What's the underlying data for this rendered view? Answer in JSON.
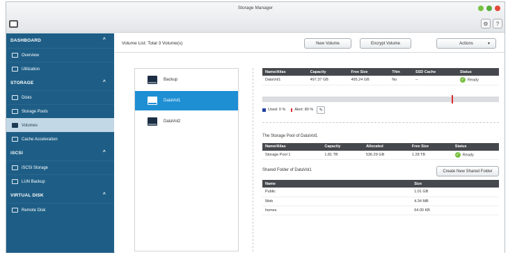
{
  "window": {
    "title": "Storage Manager"
  },
  "header": {
    "gear_icon": "⚙",
    "help_icon": "?"
  },
  "sidebar": {
    "sections": [
      {
        "label": "DASHBOARD",
        "items": [
          {
            "label": "Overview",
            "icon": "overview-icon"
          },
          {
            "label": "Utilization",
            "icon": "utilization-icon"
          }
        ]
      },
      {
        "label": "STORAGE",
        "items": [
          {
            "label": "Disks",
            "icon": "disk-icon"
          },
          {
            "label": "Storage Pools",
            "icon": "storage-pools-icon"
          },
          {
            "label": "Volumes",
            "icon": "volume-icon",
            "active": true
          },
          {
            "label": "Cache Acceleration",
            "icon": "cache-icon"
          }
        ]
      },
      {
        "label": "iSCSI",
        "items": [
          {
            "label": "iSCSI Storage",
            "icon": "iscsi-icon"
          },
          {
            "label": "LUN Backup",
            "icon": "lun-backup-icon"
          }
        ]
      },
      {
        "label": "VIRTUAL DISK",
        "items": [
          {
            "label": "Remote Disk",
            "icon": "remote-disk-icon"
          }
        ]
      }
    ],
    "chevron": "^"
  },
  "main": {
    "volume_list_title": "Volume List: Total 3 Volume(s)",
    "buttons": {
      "new_volume": "New Volume",
      "encrypt_volume": "Encrypt Volume",
      "actions": "Actions",
      "actions_caret": "▼"
    },
    "volumes": [
      "Backup",
      "DataVol1",
      "DataVol2"
    ],
    "selected_volume_index": 1
  },
  "detail": {
    "volume_table": {
      "headers": [
        "Name/Alias",
        "Capacity",
        "Free Size",
        "Thin",
        "SSD Cache",
        "Status"
      ],
      "row": [
        "DataVol1",
        "497.37 GB",
        "495.24 GB",
        "No",
        "--",
        "Ready"
      ]
    },
    "usage": {
      "used_fraction": 0.05,
      "alert_fraction": 0.8,
      "used_label": "Used: 0 %",
      "alert_label": "Alert: 80 %",
      "edit_icon": "✎"
    },
    "pool": {
      "title": "The Storage Pool of DataVol1",
      "headers": [
        "Name/Alias",
        "Capacity",
        "Allocated",
        "Free Size",
        "Status"
      ],
      "row": [
        "Storage Pool 1",
        "1.81 TB",
        "536.29 GB",
        "1.28 TB",
        "Ready"
      ]
    },
    "shared": {
      "title": "Shared Folder of DataVol1",
      "create_button": "Create New Shared Folder",
      "headers": [
        "Name",
        "Size"
      ],
      "rows": [
        [
          "Public",
          "1.01 GB"
        ],
        [
          "Web",
          "4.34 MB"
        ],
        [
          "homes",
          "64.00 KB"
        ]
      ]
    },
    "status_color": "#7ac143",
    "check_glyph": "✓"
  },
  "colors": {
    "sidebar": "#1e5e86",
    "selected": "#1f8fd4",
    "table_header": "#45484c",
    "alert": "#e0262f"
  }
}
